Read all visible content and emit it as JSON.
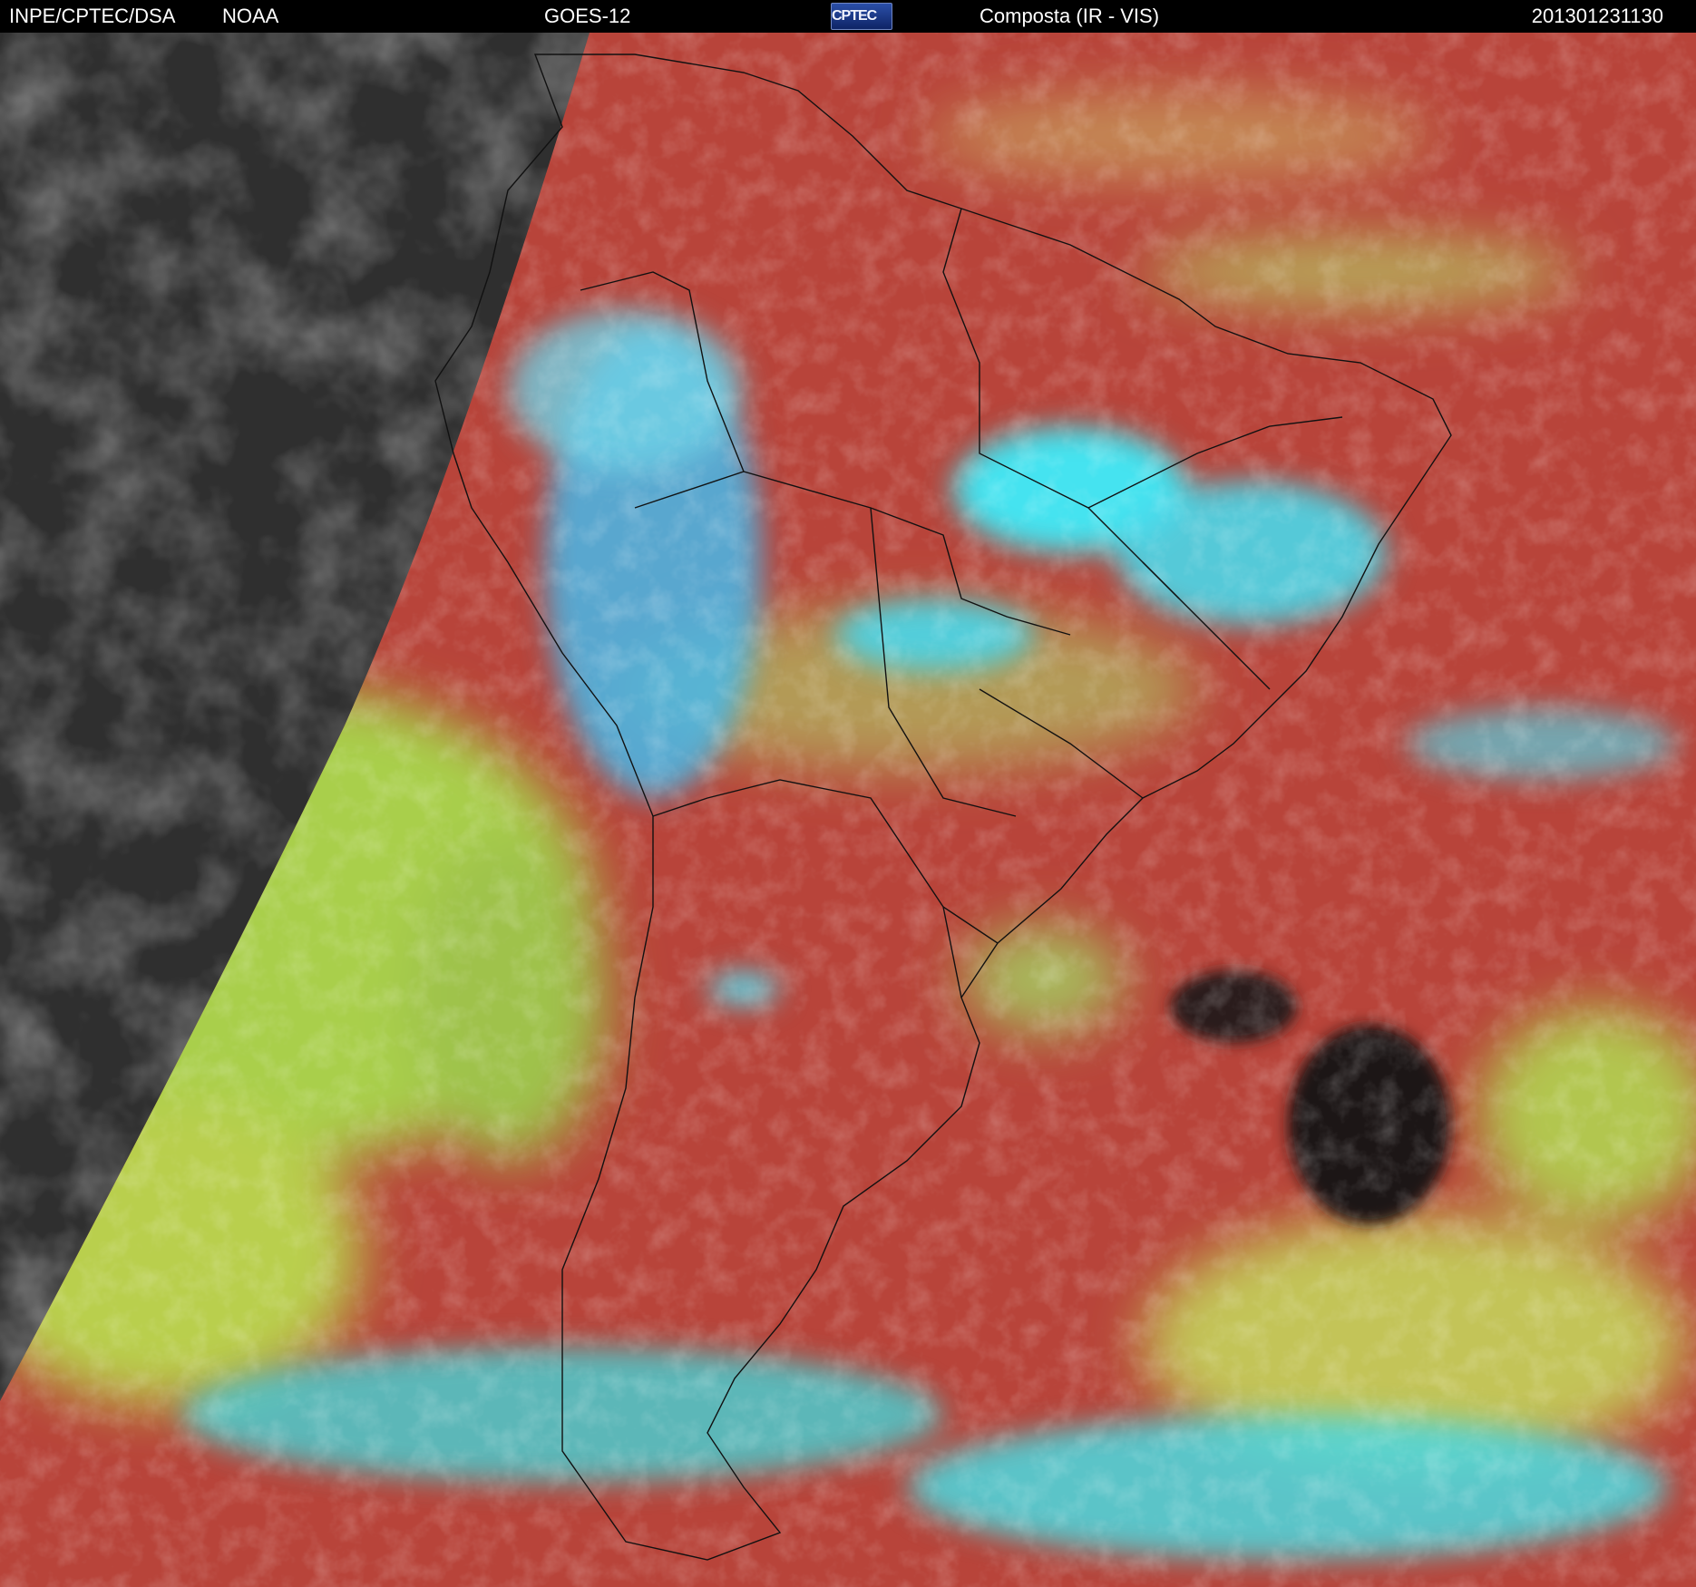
{
  "header": {
    "organization": "INPE/CPTEC/DSA",
    "agency": "NOAA",
    "satellite": "GOES-12",
    "logo_text": "CPTEC",
    "product": "Composta (IR - VIS)",
    "timestamp": "201301231130"
  },
  "colors": {
    "background": "#000000",
    "night_side": "#2f2f2f",
    "clear_surface": "#b8443a",
    "low_cloud": "#a9cf4c",
    "high_cloud": "#3fe3ec",
    "border_line": "#111111",
    "header_text": "#ffffff"
  },
  "icons": {
    "logo": "cptec-logo"
  }
}
